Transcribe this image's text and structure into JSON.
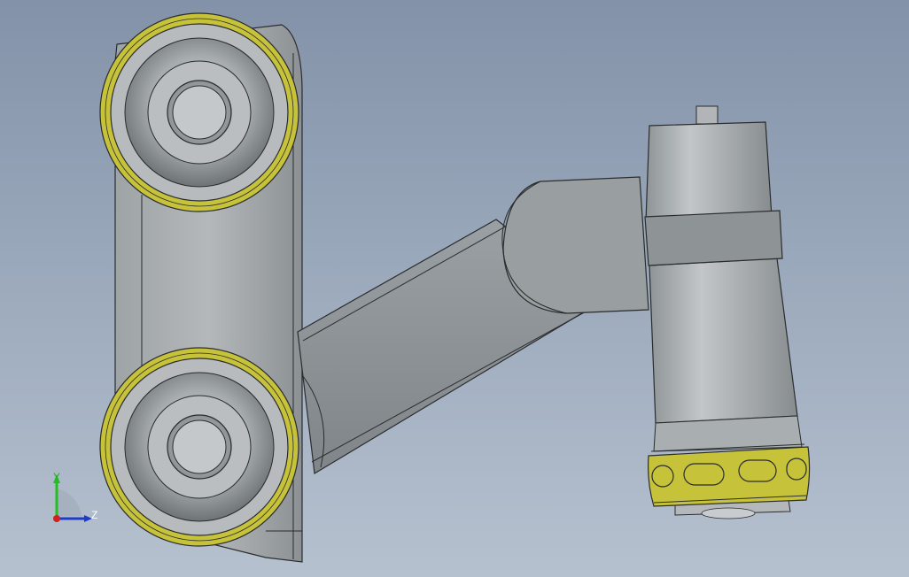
{
  "view": {
    "colors": {
      "background_top": "#8392a8",
      "background_bottom": "#b6c1cf",
      "part_gray": "#a9aeb1",
      "part_dark": "#7e8487",
      "accent_yellow": "#c8c43a"
    }
  },
  "triad": {
    "y_label": "Y",
    "z_label": "Z",
    "y_color": "#20c020",
    "z_color": "#1e3cc8",
    "x_color": "#d02020"
  }
}
